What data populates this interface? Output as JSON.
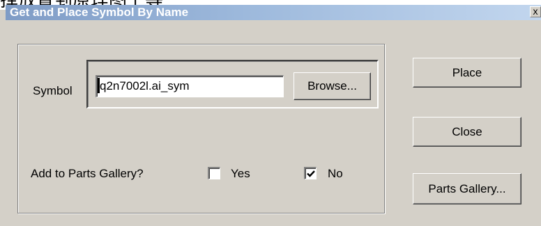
{
  "window": {
    "title": "Get and Place Symbol By Name",
    "close_glyph": "x"
  },
  "symbol": {
    "label": "Symbol",
    "value": "q2n7002l.ai_sym",
    "browse_label": "Browse..."
  },
  "gallery": {
    "question": "Add to Parts Gallery?",
    "yes_label": "Yes",
    "yes_checked": false,
    "no_label": "No",
    "no_checked": true
  },
  "actions": {
    "place_label": "Place",
    "close_label": "Close",
    "parts_gallery_label": "Parts Gallery..."
  }
}
